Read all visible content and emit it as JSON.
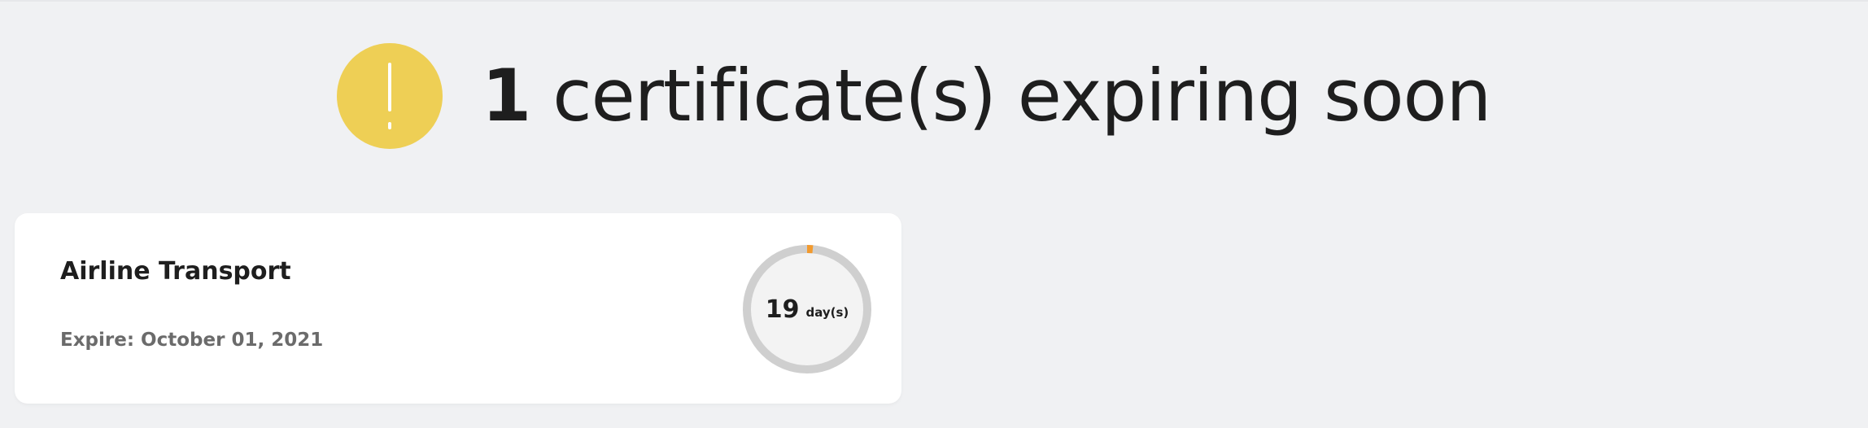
{
  "header": {
    "count": "1",
    "text": "certificate(s) expiring soon",
    "icon": "warning-exclamation-icon",
    "icon_color": "#eecf55"
  },
  "certificates": [
    {
      "title": "Airline Transport",
      "expire_label": "Expire:",
      "expire_date": "October 01, 2021",
      "days_left": "19",
      "days_unit": "day(s)",
      "progress_fraction": 0.015,
      "progress_color": "#f29a2e",
      "track_color": "#cfcfcf"
    }
  ]
}
